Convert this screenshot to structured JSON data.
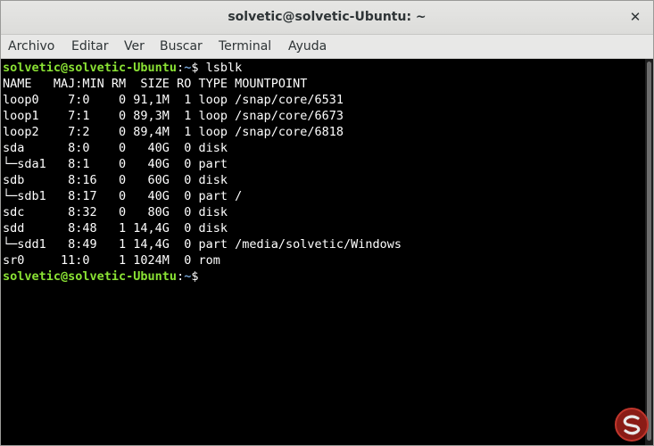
{
  "window": {
    "title": "solvetic@solvetic-Ubuntu: ~",
    "close_icon": "close-icon"
  },
  "menu": {
    "items": [
      {
        "label": "Archivo"
      },
      {
        "label": "Editar"
      },
      {
        "label": "Ver"
      },
      {
        "label": "Buscar"
      },
      {
        "label": "Terminal"
      },
      {
        "label": "Ayuda"
      }
    ]
  },
  "colors": {
    "prompt_user": "#8ae234",
    "prompt_path": "#729fcf",
    "terminal_bg": "#000000",
    "terminal_fg": "#ffffff"
  },
  "terminal": {
    "prompt_user": "solvetic@solvetic-Ubuntu",
    "prompt_sep": ":",
    "prompt_path": "~",
    "prompt_symbol": "$",
    "command": " lsblk",
    "output": [
      "NAME   MAJ:MIN RM  SIZE RO TYPE MOUNTPOINT",
      "loop0    7:0    0 91,1M  1 loop /snap/core/6531",
      "loop1    7:1    0 89,3M  1 loop /snap/core/6673",
      "loop2    7:2    0 89,4M  1 loop /snap/core/6818",
      "sda      8:0    0   40G  0 disk",
      "└─sda1   8:1    0   40G  0 part",
      "sdb      8:16   0   60G  0 disk",
      "└─sdb1   8:17   0   40G  0 part /",
      "sdc      8:32   0   80G  0 disk",
      "sdd      8:48   1 14,4G  0 disk",
      "└─sdd1   8:49   1 14,4G  0 part /media/solvetic/Windows",
      "sr0     11:0    1 1024M  0 rom"
    ]
  },
  "watermark_icon": "solvetic-logo-icon"
}
